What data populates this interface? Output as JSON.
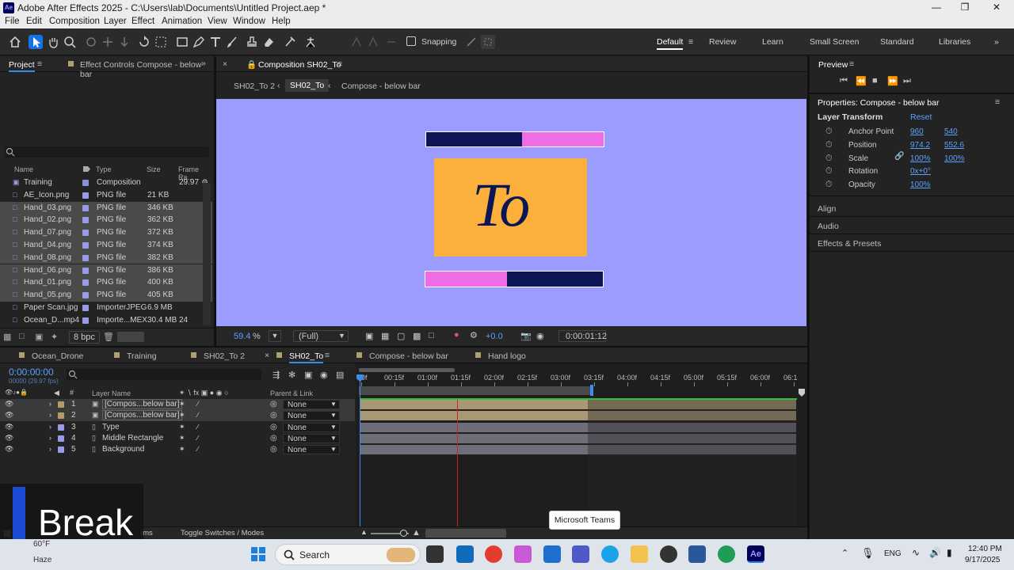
{
  "window": {
    "title": "Adobe After Effects 2025 - C:\\Users\\lab\\Documents\\Untitled Project.aep *"
  },
  "menu": [
    "File",
    "Edit",
    "Composition",
    "Layer",
    "Effect",
    "Animation",
    "View",
    "Window",
    "Help"
  ],
  "toolbar": {
    "snapping": "Snapping"
  },
  "workspaces": [
    "Default",
    "Review",
    "Learn",
    "Small Screen",
    "Standard",
    "Libraries"
  ],
  "project": {
    "tab": "Project",
    "tab2": "Effect Controls Compose - below bar",
    "columns": [
      "Name",
      "Type",
      "Size",
      "Frame Ra..."
    ],
    "rows": [
      {
        "name": "Training",
        "type": "Composition",
        "size": "",
        "fps": "29.97",
        "color": "#8a8fd8",
        "sel": false
      },
      {
        "name": "AE_Icon.png",
        "type": "PNG file",
        "size": "21 KB",
        "fps": "",
        "color": "#9a9ae6",
        "sel": false
      },
      {
        "name": "Hand_03.png",
        "type": "PNG file",
        "size": "346 KB",
        "fps": "",
        "color": "#9a9ae6",
        "sel": true
      },
      {
        "name": "Hand_02.png",
        "type": "PNG file",
        "size": "362 KB",
        "fps": "",
        "color": "#9a9ae6",
        "sel": true
      },
      {
        "name": "Hand_07.png",
        "type": "PNG file",
        "size": "372 KB",
        "fps": "",
        "color": "#9a9ae6",
        "sel": true
      },
      {
        "name": "Hand_04.png",
        "type": "PNG file",
        "size": "374 KB",
        "fps": "",
        "color": "#9a9ae6",
        "sel": true
      },
      {
        "name": "Hand_08.png",
        "type": "PNG file",
        "size": "382 KB",
        "fps": "",
        "color": "#9a9ae6",
        "sel": true
      },
      {
        "name": "Hand_06.png",
        "type": "PNG file",
        "size": "386 KB",
        "fps": "",
        "color": "#9a9ae6",
        "sel": true
      },
      {
        "name": "Hand_01.png",
        "type": "PNG file",
        "size": "400 KB",
        "fps": "",
        "color": "#9a9ae6",
        "sel": true
      },
      {
        "name": "Hand_05.png",
        "type": "PNG file",
        "size": "405 KB",
        "fps": "",
        "color": "#9a9ae6",
        "sel": true
      },
      {
        "name": "Paper Scan.jpg",
        "type": "ImporterJPEG",
        "size": "6.9 MB",
        "fps": "",
        "color": "#9a9ae6",
        "sel": false
      },
      {
        "name": "Ocean_D...mp4",
        "type": "Importe...MEX",
        "size": "30.4 MB",
        "fps": "24",
        "color": "#9a9ae6",
        "sel": false
      }
    ],
    "bpc": "8 bpc"
  },
  "comp": {
    "tab": "Composition SH02_To",
    "crumbs": [
      "SH02_To 2",
      "SH02_To",
      "Compose - below bar"
    ],
    "logo_text": "To",
    "zoom": "59.4",
    "zoom_unit": "%",
    "quality": "(Full)",
    "exposure": "+0.0",
    "timecode": "0:00:01:12",
    "colors": {
      "bg": "#9c9cff",
      "navy": "#0c1656",
      "pink": "#f06ce6",
      "orange": "#fbb03b"
    }
  },
  "preview": {
    "title": "Preview"
  },
  "properties": {
    "title": "Properties: Compose - below bar",
    "section": "Layer Transform",
    "reset": "Reset",
    "rows": [
      {
        "label": "Anchor Point",
        "v1": "960",
        "v2": "540"
      },
      {
        "label": "Position",
        "v1": "974.2",
        "v2": "552.6"
      },
      {
        "label": "Scale",
        "v1": "100%",
        "v2": "100%"
      },
      {
        "label": "Rotation",
        "v1": "0x+0°",
        "v2": ""
      },
      {
        "label": "Opacity",
        "v1": "100%",
        "v2": ""
      }
    ],
    "panels": [
      "Align",
      "Audio",
      "Effects & Presets"
    ]
  },
  "timeline": {
    "tabs": [
      {
        "label": "Ocean_Drone",
        "color": "#b0a070"
      },
      {
        "label": "Training",
        "color": "#b0a070"
      },
      {
        "label": "SH02_To 2",
        "color": "#b0a070"
      },
      {
        "label": "SH02_To",
        "color": "#b0a070"
      },
      {
        "label": "Compose - below bar",
        "color": "#b0a070"
      },
      {
        "label": "Hand logo",
        "color": "#b0a070"
      }
    ],
    "timecode": "0:00:00:00",
    "fps": "00000 (29.97 fps)",
    "col_layer": "Layer Name",
    "col_parent": "Parent & Link",
    "ruler": [
      "0f",
      "00:15f",
      "01:00f",
      "01:15f",
      "02:00f",
      "02:15f",
      "03:00f",
      "03:15f",
      "04:00f",
      "04:15f",
      "05:00f",
      "05:15f",
      "06:00f",
      "06:1"
    ],
    "layers": [
      {
        "num": "1",
        "name": "[Compos...below bar]",
        "parent": "None",
        "color": "#b89a6a"
      },
      {
        "num": "2",
        "name": "[Compos...below bar]",
        "parent": "None",
        "color": "#b89a6a"
      },
      {
        "num": "3",
        "name": "Type",
        "parent": "None",
        "color": "#9a9ae6"
      },
      {
        "num": "4",
        "name": "Middle Rectangle",
        "parent": "None",
        "color": "#9a9ae6"
      },
      {
        "num": "5",
        "name": "Background",
        "parent": "None",
        "color": "#9a9ae6"
      }
    ],
    "toggle": "Toggle Switches / Modes",
    "frame_render": "ims"
  },
  "tooltip": "Microsoft Teams",
  "overlay": {
    "text": "Break",
    "sub1": "60°F",
    "sub2": "Haze"
  },
  "taskbar": {
    "search": "Search",
    "lang": "ENG",
    "time": "12:40 PM",
    "date": "9/17/2025"
  }
}
